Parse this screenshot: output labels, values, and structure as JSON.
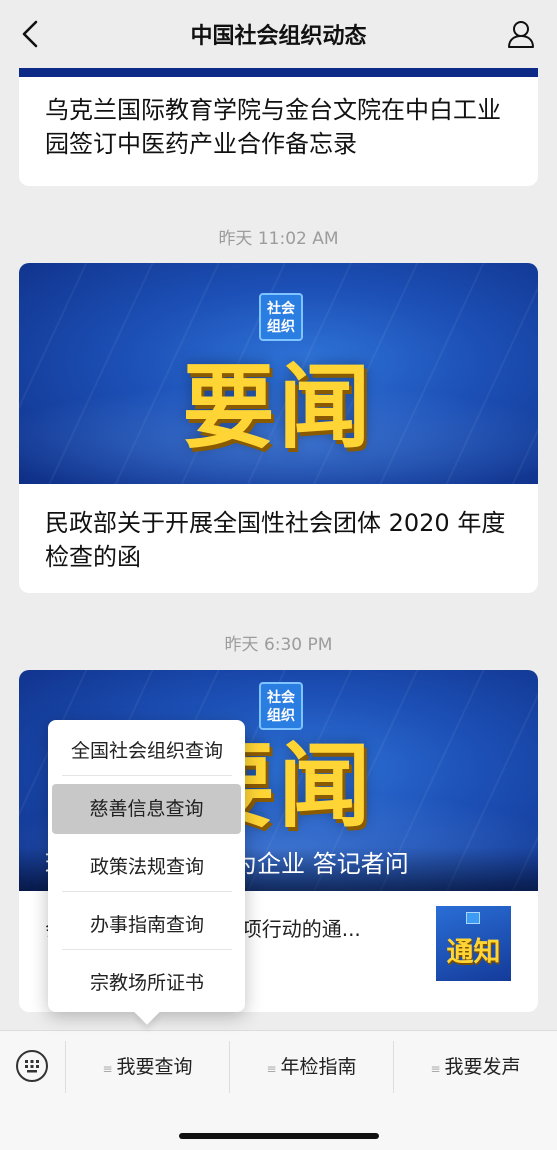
{
  "header": {
    "title": "中国社会组织动态"
  },
  "feed": {
    "card1": {
      "title": "乌克兰国际教育学院与金台文院在中白工业园签订中医药产业合作备忘录"
    },
    "time1": "昨天 11:02 AM",
    "card2": {
      "badge": "社会组织",
      "headline": "要闻",
      "title": "民政部关于开展全国性社会团体 2020 年度检查的函"
    },
    "time2": "昨天 6:30 PM",
    "card3": {
      "badge": "社会组织",
      "headline": "要闻",
      "caption": "理局负责人就 “我为企业  答记者问",
      "sub_text": "会商会领域组织  担”专项行动的通...",
      "thumb_title": "通知"
    }
  },
  "popup_menu": {
    "items": [
      {
        "label": "全国社会组织查询"
      },
      {
        "label": "慈善信息查询",
        "selected": true
      },
      {
        "label": "政策法规查询"
      },
      {
        "label": "办事指南查询"
      },
      {
        "label": "宗教场所证书"
      }
    ]
  },
  "bottom_menu": {
    "items": [
      {
        "label": "我要查询"
      },
      {
        "label": "年检指南"
      },
      {
        "label": "我要发声"
      }
    ]
  },
  "colors": {
    "accent_yellow": "#ffd535",
    "banner_blue": "#1c4fb5",
    "background": "#ededed"
  }
}
